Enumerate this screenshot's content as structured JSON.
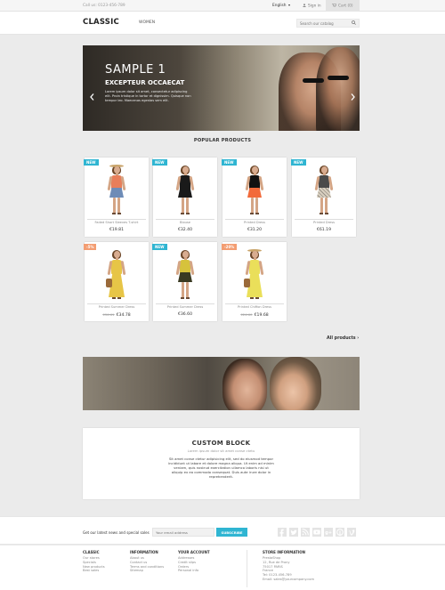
{
  "topbar": {
    "call": "Call us: 0123-456-789",
    "language": "English",
    "signin": "Sign in",
    "cart": "Cart (0)"
  },
  "header": {
    "logo": "CLASSIC",
    "menu": [
      "WOMEN"
    ],
    "search_placeholder": "Search our catalog"
  },
  "slider": {
    "title": "SAMPLE 1",
    "subtitle": "EXCEPTEUR OCCAECAT",
    "text": "Lorem ipsum dolor sit amet, consectetur adipiscing elit. Proin tristique in tortor et dignissim. Quisque non tempor leo. Maecenas egestas sem elit."
  },
  "popular": {
    "title": "POPULAR PRODUCTS",
    "all_link": "All products",
    "products": [
      {
        "badge": "NEW",
        "badge_type": "new",
        "name": "Faded Short Sleeves T-shirt",
        "price": "€19.81",
        "old_price": ""
      },
      {
        "badge": "NEW",
        "badge_type": "new",
        "name": "Blouse",
        "price": "€32.40",
        "old_price": ""
      },
      {
        "badge": "NEW",
        "badge_type": "new",
        "name": "Printed Dress",
        "price": "€31.20",
        "old_price": ""
      },
      {
        "badge": "NEW",
        "badge_type": "new",
        "name": "Printed Dress",
        "price": "€61.19",
        "old_price": ""
      },
      {
        "badge": "-5%",
        "badge_type": "disc",
        "name": "Printed Summer Dress",
        "price": "€34.78",
        "old_price": "€36.61"
      },
      {
        "badge": "NEW",
        "badge_type": "new",
        "name": "Printed Summer Dress",
        "price": "€36.60",
        "old_price": ""
      },
      {
        "badge": "-20%",
        "badge_type": "disc",
        "name": "Printed Chiffon Dress",
        "price": "€19.68",
        "old_price": "€24.60"
      }
    ]
  },
  "custom_block": {
    "title": "CUSTOM BLOCK",
    "subtitle": "Lorem ipsum dolor sit amet conse ctetu",
    "text": "Sit amet conse ctetur adipisicing elit, sed do eiusmod tempor incididunt ut labore et dolore magna aliqua. Ut enim ad minim veniam, quis nostrud exercitation ullamco laboris nisi ut aliquip ex ea commodo consequat. Duis aute irure dolor in reprehenderit."
  },
  "newsletter": {
    "label": "Get our latest news and special sales",
    "placeholder": "Your email address",
    "button": "SUBSCRIBE",
    "social_icons": [
      "facebook-icon",
      "twitter-icon",
      "rss-icon",
      "youtube-icon",
      "googleplus-icon",
      "pinterest-icon",
      "vimeo-icon"
    ]
  },
  "footer": {
    "columns": [
      {
        "title": "CLASSIC",
        "items": [
          "Our stores",
          "Specials",
          "New products",
          "Best sales"
        ]
      },
      {
        "title": "INFORMATION",
        "items": [
          "About us",
          "Contact us",
          "Terms and conditions",
          "Sitemap"
        ]
      },
      {
        "title": "YOUR ACCOUNT",
        "items": [
          "Addresses",
          "Credit slips",
          "Orders",
          "Personal info"
        ]
      }
    ],
    "store": {
      "title": "STORE INFORMATION",
      "lines": [
        "PrestaShop",
        "12, Rue de Prony",
        "75017 PARIS",
        "France",
        "Tel: 0123-456-789",
        "Email: sales@yourcompany.com"
      ]
    }
  }
}
